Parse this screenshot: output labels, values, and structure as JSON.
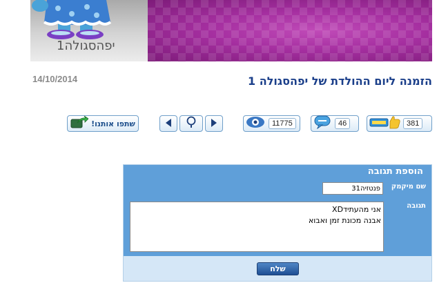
{
  "banner": {
    "avatar_name": "יפהסגולה1"
  },
  "post": {
    "title": "הזמנה ליום ההולדת של יפהסגולה 1",
    "date": "14/10/2014"
  },
  "toolbar": {
    "share_label": "שתפו אותנו!",
    "views_count": "11775",
    "comments_count": "46",
    "likes_count": "381"
  },
  "form": {
    "header": "הוספת תגובה",
    "nickname_label": "שם מיקמק",
    "nickname_value": "פנטזיה31",
    "reply_label": "תגובה",
    "reply_value": "אני מהעתידXD\nאבנה מכונת זמן ואבוא",
    "send_label": "שלח"
  }
}
